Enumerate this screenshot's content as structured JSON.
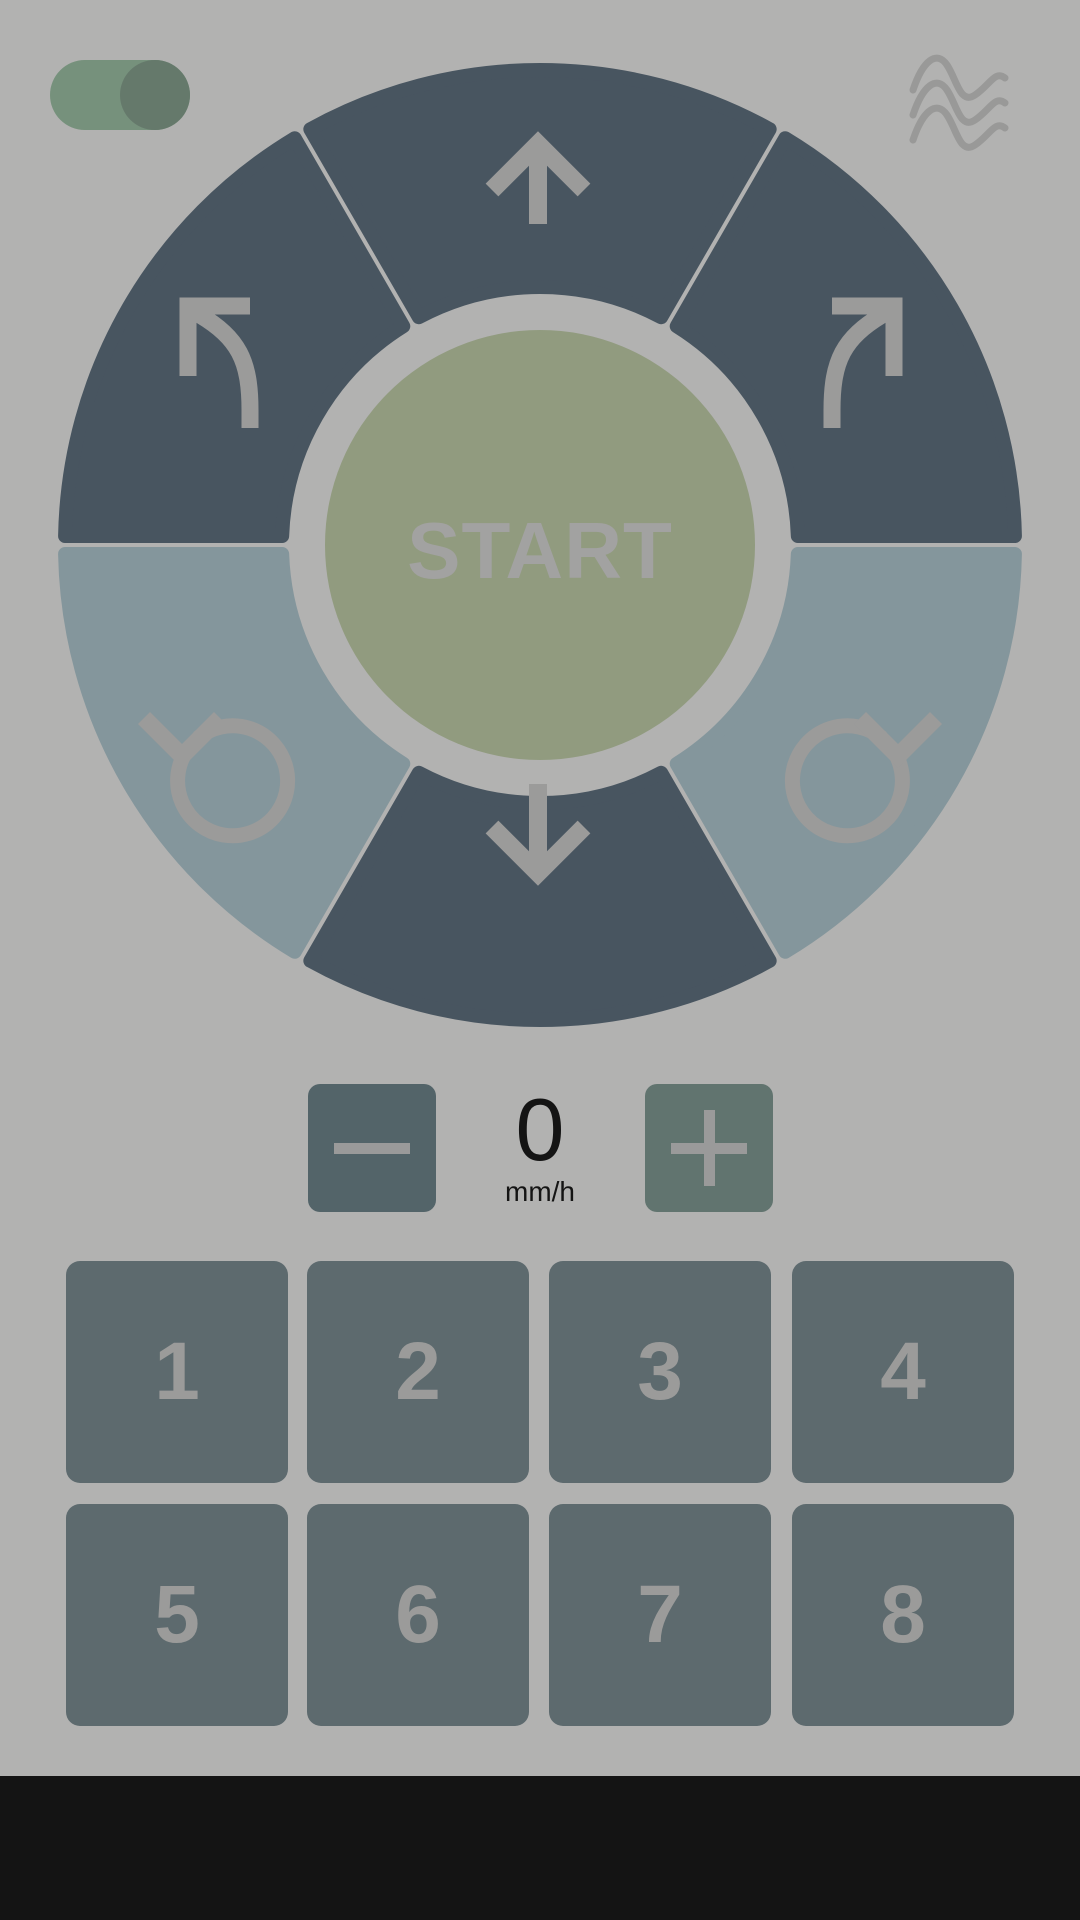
{
  "colors": {
    "background": "#b2b2b1",
    "segment_dark": "#485560",
    "segment_light": "#84969c",
    "start_fill": "#919b7f",
    "icon_gray": "#9b9b9a",
    "toggle_track": "#76917c",
    "toggle_knob": "#65796b",
    "minus_button": "#536469",
    "plus_button": "#61746f",
    "keypad": "#5d6a6e",
    "navbar": "#141414"
  },
  "header": {
    "toggle": {
      "state": "on",
      "icon": "toggle-switch"
    },
    "right_icon": "waves-icon"
  },
  "controls": {
    "start_label": "START",
    "directions": [
      {
        "id": "forward",
        "icon": "arrow-up-icon"
      },
      {
        "id": "turn_left",
        "icon": "turn-left-arrow-icon"
      },
      {
        "id": "turn_right",
        "icon": "turn-right-arrow-icon"
      },
      {
        "id": "rotate_left",
        "icon": "rotate-ccw-icon"
      },
      {
        "id": "rotate_right",
        "icon": "rotate-cw-icon"
      },
      {
        "id": "backward",
        "icon": "arrow-down-icon"
      }
    ]
  },
  "speed": {
    "value": "0",
    "unit": "mm/h",
    "minus_icon": "minus-icon",
    "plus_icon": "plus-icon"
  },
  "keypad": {
    "keys": [
      "1",
      "2",
      "3",
      "4",
      "5",
      "6",
      "7",
      "8"
    ]
  }
}
